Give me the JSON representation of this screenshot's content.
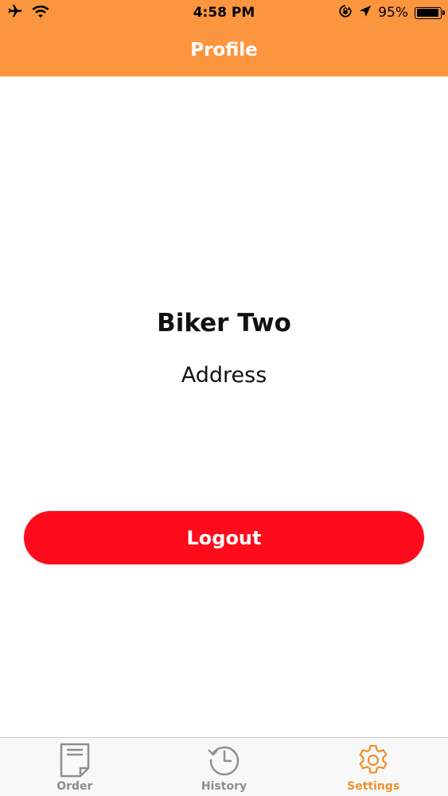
{
  "status_bar": {
    "time": "4:58 PM",
    "battery_percent": "95%",
    "battery_level": 0.95,
    "icons": {
      "airplane": "airplane-icon",
      "wifi": "wifi-icon",
      "rotation_lock": "rotation-lock-icon",
      "location": "location-arrow-icon",
      "battery": "battery-icon"
    }
  },
  "header": {
    "title": "Profile",
    "background_color": "#fb963f"
  },
  "profile": {
    "name": "Biker Two",
    "address": "Address"
  },
  "actions": {
    "logout_label": "Logout",
    "logout_color": "#ff0b1c"
  },
  "tab_bar": {
    "tabs": [
      {
        "label": "Order",
        "icon": "order-document-icon",
        "active": false
      },
      {
        "label": "History",
        "icon": "history-clock-icon",
        "active": false
      },
      {
        "label": "Settings",
        "icon": "settings-gear-icon",
        "active": true
      }
    ],
    "active_color": "#f0922d",
    "inactive_color": "#8e8e8e"
  }
}
